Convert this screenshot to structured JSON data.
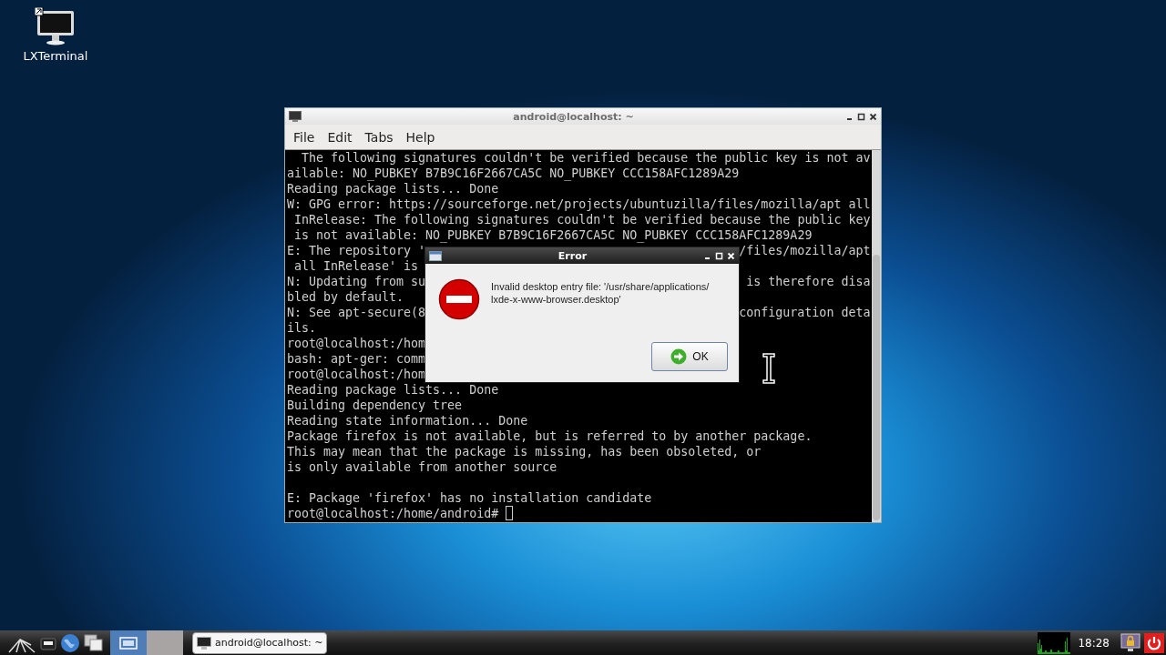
{
  "desktop": {
    "icons": [
      {
        "label": "LXTerminal"
      }
    ]
  },
  "terminal_window": {
    "title": "android@localhost: ~",
    "menu": [
      "File",
      "Edit",
      "Tabs",
      "Help"
    ],
    "lines": [
      {
        "kind": "full",
        "text": "  The following signatures couldn't be verified because the public key is not av"
      },
      {
        "kind": "full",
        "text": "ailable: NO_PUBKEY B7B9C16F2667CA5C NO_PUBKEY CCC158AFC1289A29"
      },
      {
        "kind": "full",
        "text": "Reading package lists... Done"
      },
      {
        "kind": "full",
        "text": "W: GPG error: https://sourceforge.net/projects/ubuntuzilla/files/mozilla/apt all"
      },
      {
        "kind": "full",
        "text": " InRelease: The following signatures couldn't be verified because the public key"
      },
      {
        "kind": "full",
        "text": " is not available: NO_PUBKEY B7B9C16F2667CA5C NO_PUBKEY CCC158AFC1289A29"
      },
      {
        "kind": "split",
        "left": "E: The repository '",
        "right": "/files/mozilla/apt"
      },
      {
        "kind": "full",
        "text": " all InRelease' is"
      },
      {
        "kind": "split",
        "left": "N: Updating from su",
        "right": "is therefore disa"
      },
      {
        "kind": "full",
        "text": "bled by default."
      },
      {
        "kind": "split",
        "left": "N: See apt-secure(8",
        "right": "configuration deta"
      },
      {
        "kind": "full",
        "text": "ils."
      },
      {
        "kind": "full",
        "text": "root@localhost:/hom"
      },
      {
        "kind": "full",
        "text": "bash: apt-ger: comm"
      },
      {
        "kind": "full",
        "text": "root@localhost:/hom"
      },
      {
        "kind": "full",
        "text": "Reading package lists... Done"
      },
      {
        "kind": "full",
        "text": "Building dependency tree"
      },
      {
        "kind": "full",
        "text": "Reading state information... Done"
      },
      {
        "kind": "full",
        "text": "Package firefox is not available, but is referred to by another package."
      },
      {
        "kind": "full",
        "text": "This may mean that the package is missing, has been obsoleted, or"
      },
      {
        "kind": "full",
        "text": "is only available from another source"
      },
      {
        "kind": "blank"
      },
      {
        "kind": "full",
        "text": "E: Package 'firefox' has no installation candidate"
      },
      {
        "kind": "prompt",
        "text": "root@localhost:/home/android# "
      }
    ]
  },
  "dialog": {
    "title": "Error",
    "message_lines": [
      "Invalid desktop entry file: '/usr/share/applications/",
      "lxde-x-www-browser.desktop'"
    ],
    "button": "OK"
  },
  "taskbar": {
    "workspaces": [
      {
        "selected": true
      },
      {
        "selected": false
      }
    ],
    "tasks": [
      {
        "label": "android@localhost: ~"
      }
    ],
    "clock": "18:28"
  }
}
